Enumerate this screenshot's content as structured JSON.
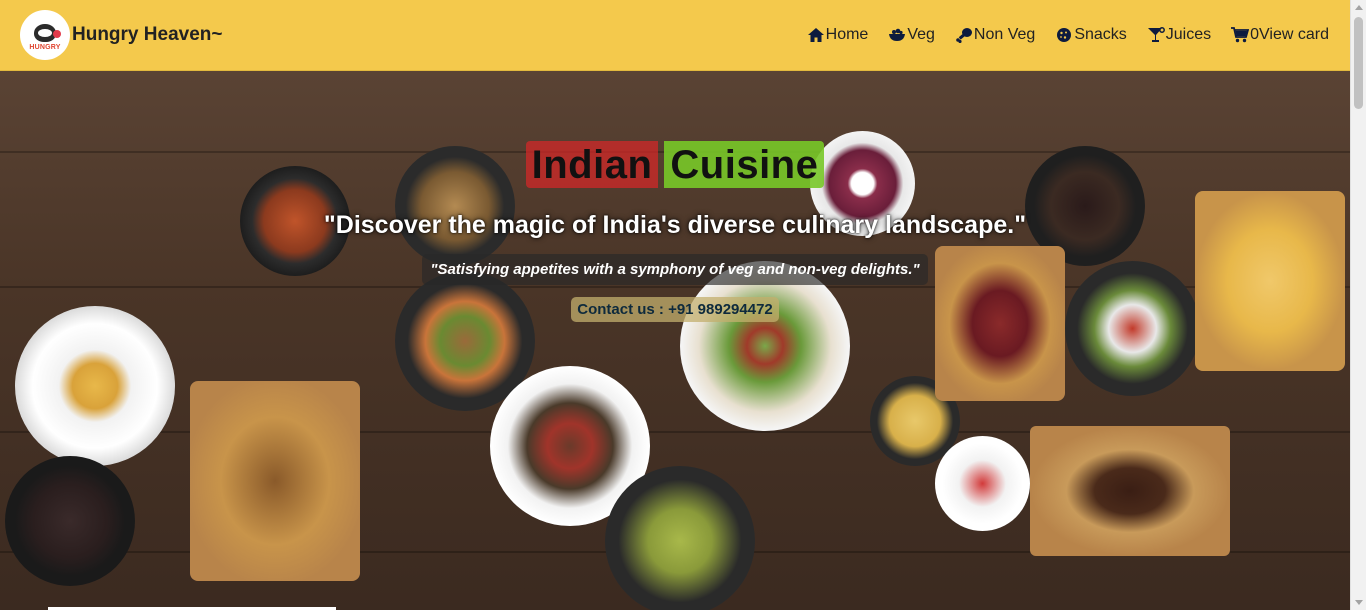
{
  "brand": {
    "logo_text": "HUNGRY",
    "title": "Hungry Heaven~"
  },
  "nav": {
    "items": [
      {
        "label": "Home",
        "icon": "home-icon"
      },
      {
        "label": "Veg",
        "icon": "bowl-icon"
      },
      {
        "label": "Non Veg",
        "icon": "drumstick-icon"
      },
      {
        "label": "Snacks",
        "icon": "cookie-icon"
      },
      {
        "label": "Juices",
        "icon": "cocktail-icon"
      },
      {
        "label": "0View card",
        "icon": "cart-icon"
      }
    ]
  },
  "hero": {
    "headline_word1": "Indian",
    "headline_word2": "Cuisine",
    "tagline": "\"Discover the magic of India's diverse culinary landscape.\"",
    "subtagline": "\"Satisfying appetites with a symphony of veg and non-veg delights.\"",
    "contact": "Contact us : +91 989294472"
  },
  "colors": {
    "navbar": "#f4c94c",
    "headline_red": "#d22828",
    "headline_green": "#78c828"
  }
}
